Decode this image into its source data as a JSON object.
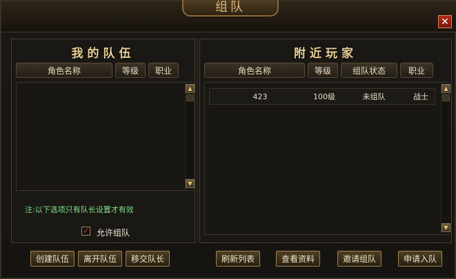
{
  "window": {
    "title": "组队",
    "close_label": "✕"
  },
  "my_team": {
    "title": "我的队伍",
    "columns": [
      "角色名称",
      "等级",
      "职业"
    ],
    "rows": []
  },
  "nearby": {
    "title": "附近玩家",
    "columns": [
      "角色名称",
      "等级",
      "组队状态",
      "职业"
    ],
    "rows": [
      {
        "name": "423",
        "level": "100级",
        "status": "未组队",
        "class": "战士"
      }
    ]
  },
  "note": "注:以下选项只有队长设置才有效",
  "allow_team": {
    "label": "允许组队",
    "checked": true
  },
  "left_buttons": {
    "create": "创建队伍",
    "leave": "离开队伍",
    "transfer": "移交队长"
  },
  "right_buttons": {
    "refresh": "刷新列表",
    "view": "查看资料",
    "invite": "邀请组队",
    "apply": "申请入队"
  }
}
